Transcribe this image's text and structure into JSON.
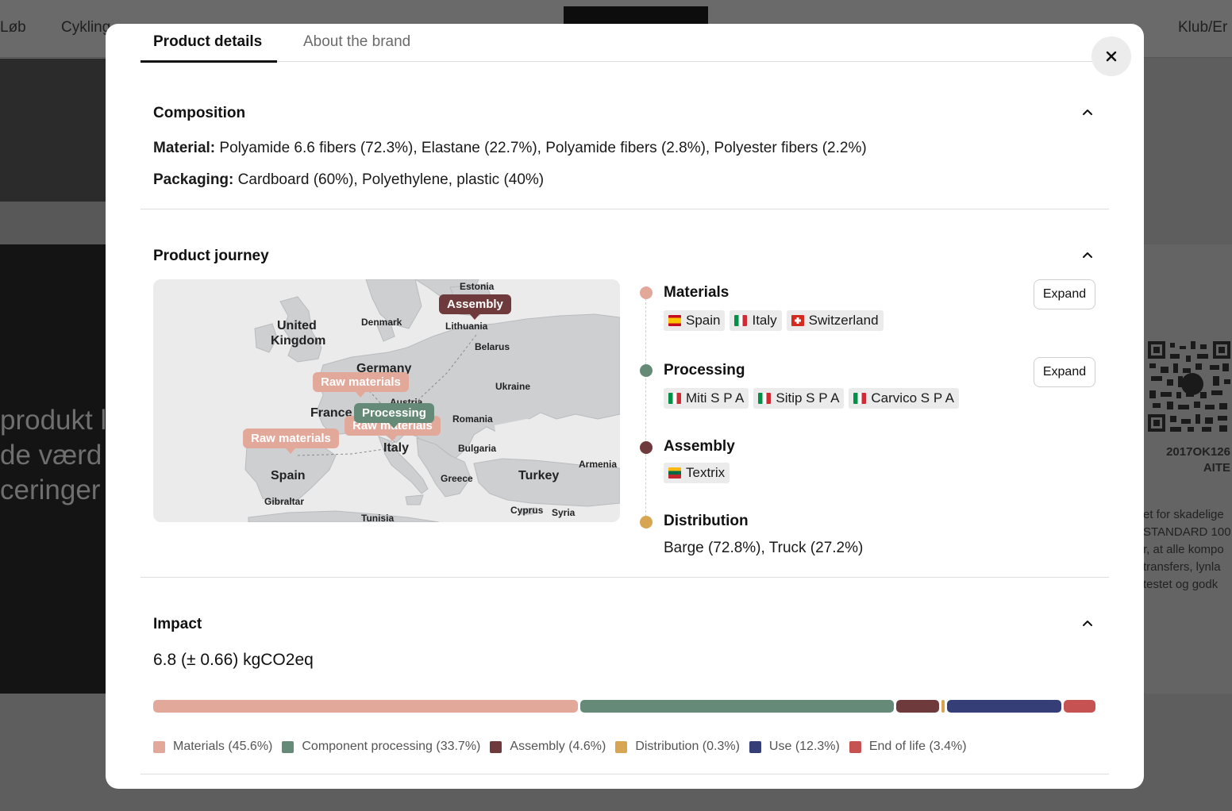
{
  "background": {
    "nav": [
      "Løb",
      "Cykling",
      "Klub/Er"
    ],
    "hero_lines": [
      "produkt l",
      "de værd",
      "ceringer"
    ],
    "right_code": [
      "2017OK126",
      "AITE"
    ],
    "right_text": [
      "et for skadelige",
      "STANDARD 100",
      "r, at alle kompo",
      "transfers, lynla",
      "testet og godk"
    ]
  },
  "tabs": [
    {
      "label": "Product details",
      "active": true
    },
    {
      "label": "About the brand",
      "active": false
    }
  ],
  "close_icon": "close-icon",
  "composition": {
    "title": "Composition",
    "material_label": "Material:",
    "material_value": "Polyamide 6.6 fibers (72.3%), Elastane (22.7%), Polyamide fibers (2.8%), Polyester fibers (2.2%)",
    "packaging_label": "Packaging:",
    "packaging_value": "Cardboard (60%), Polyethylene, plastic (40%)"
  },
  "journey": {
    "title": "Product journey",
    "map": {
      "countries": [
        "Estonia",
        "United",
        "Kingdom",
        "Denmark",
        "Lithuania",
        "Belarus",
        "Germany",
        "Ukraine",
        "France",
        "Austria",
        "Romania",
        "Italy",
        "Bulgaria",
        "Spain",
        "Armenia",
        "Greece",
        "Turkey",
        "Gibraltar",
        "Cyprus",
        "Syria",
        "Tunisia"
      ],
      "tags": {
        "assembly": "Assembly",
        "raw1": "Raw materials",
        "processing": "Processing",
        "raw2": "Raw materials",
        "raw3": "Raw materials"
      }
    },
    "steps": [
      {
        "title": "Materials",
        "color": "#e2a99b",
        "expand": "Expand",
        "chips": [
          {
            "flag": "es",
            "label": "Spain"
          },
          {
            "flag": "it",
            "label": "Italy"
          },
          {
            "flag": "ch",
            "label": "Switzerland"
          }
        ]
      },
      {
        "title": "Processing",
        "color": "#658a78",
        "expand": "Expand",
        "chips": [
          {
            "flag": "it",
            "label": "Miti S P A"
          },
          {
            "flag": "it",
            "label": "Sitip S P A"
          },
          {
            "flag": "it",
            "label": "Carvico S P A"
          }
        ]
      },
      {
        "title": "Assembly",
        "color": "#6e3a3c",
        "chips": [
          {
            "flag": "lt",
            "label": "Textrix"
          }
        ]
      },
      {
        "title": "Distribution",
        "color": "#d8a552",
        "text": "Barge (72.8%), Truck (27.2%)"
      }
    ]
  },
  "impact": {
    "title": "Impact",
    "value": "6.8 (± 0.66) kgCO2eq",
    "segments": [
      {
        "label": "Materials (45.6%)",
        "pct": 45.6,
        "color": "#e2a99b"
      },
      {
        "label": "Component processing (33.7%)",
        "pct": 33.7,
        "color": "#658a78"
      },
      {
        "label": "Assembly (4.6%)",
        "pct": 4.6,
        "color": "#6e3a3c"
      },
      {
        "label": "Distribution (0.3%)",
        "pct": 0.3,
        "color": "#d8a552"
      },
      {
        "label": "Use (12.3%)",
        "pct": 12.3,
        "color": "#363e78"
      },
      {
        "label": "End of life (3.4%)",
        "pct": 3.4,
        "color": "#c75252"
      }
    ]
  }
}
